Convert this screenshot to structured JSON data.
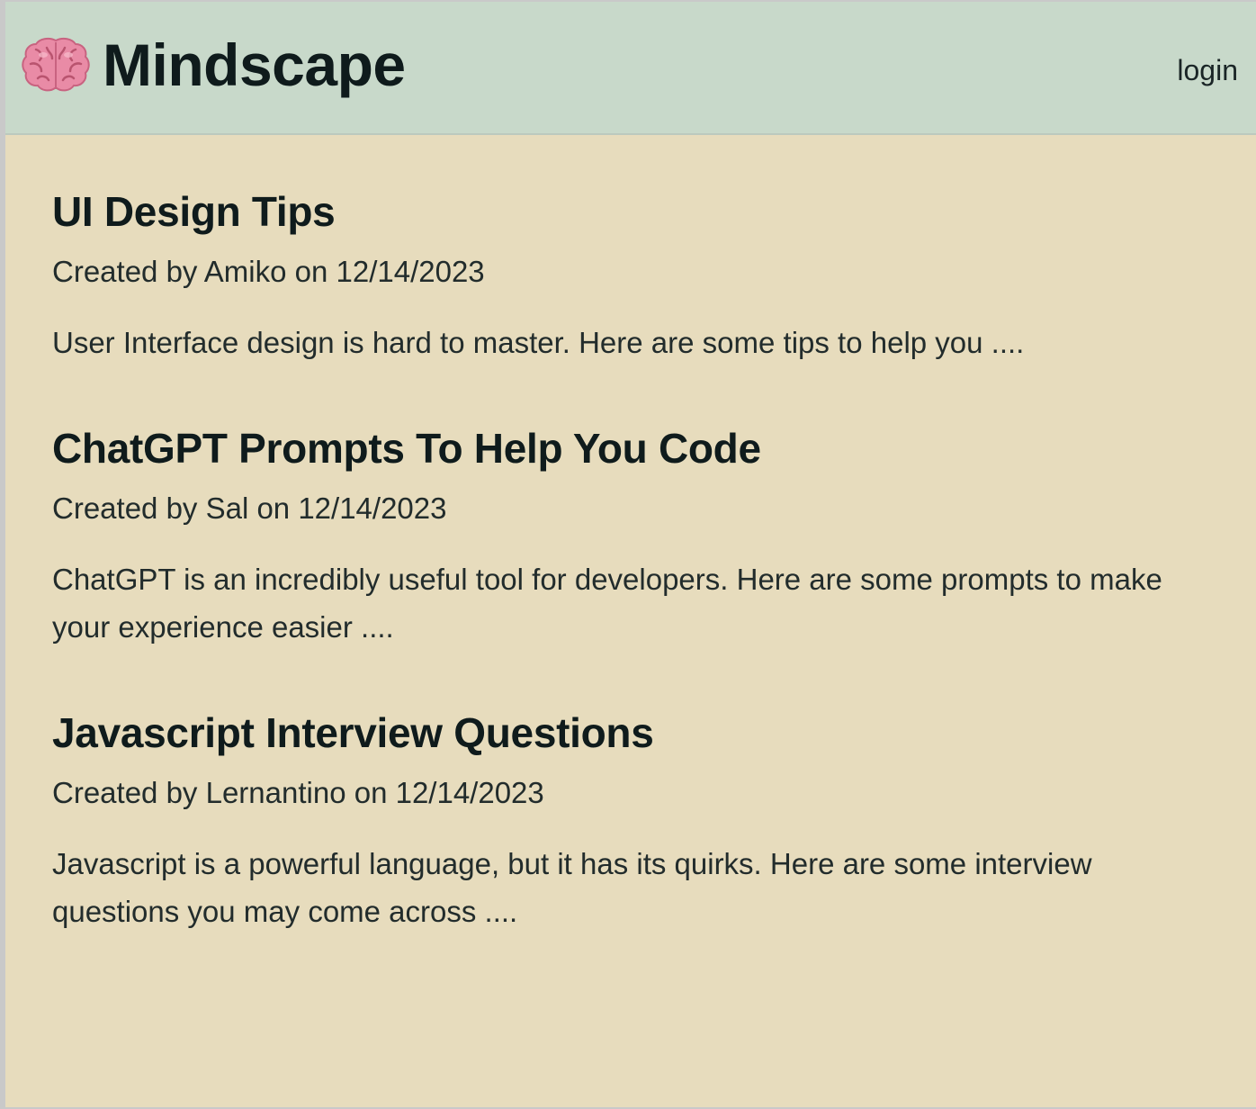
{
  "header": {
    "brand_icon": "brain-icon",
    "app_title": "Mindscape",
    "login_label": "login",
    "background_color": "#c8d9ca"
  },
  "main": {
    "background_color": "#e7dcbd",
    "posts": [
      {
        "title": "UI Design Tips",
        "meta": "Created by Amiko on 12/14/2023",
        "excerpt": "User Interface design is hard to master. Here are some tips to help you ...."
      },
      {
        "title": "ChatGPT Prompts To Help You Code",
        "meta": "Created by Sal on 12/14/2023",
        "excerpt": "ChatGPT is an incredibly useful tool for developers. Here are some prompts to make your experience easier ...."
      },
      {
        "title": "Javascript Interview Questions",
        "meta": "Created by Lernantino on 12/14/2023",
        "excerpt": "Javascript is a powerful language, but it has its quirks. Here are some interview questions you may come across ...."
      }
    ]
  }
}
